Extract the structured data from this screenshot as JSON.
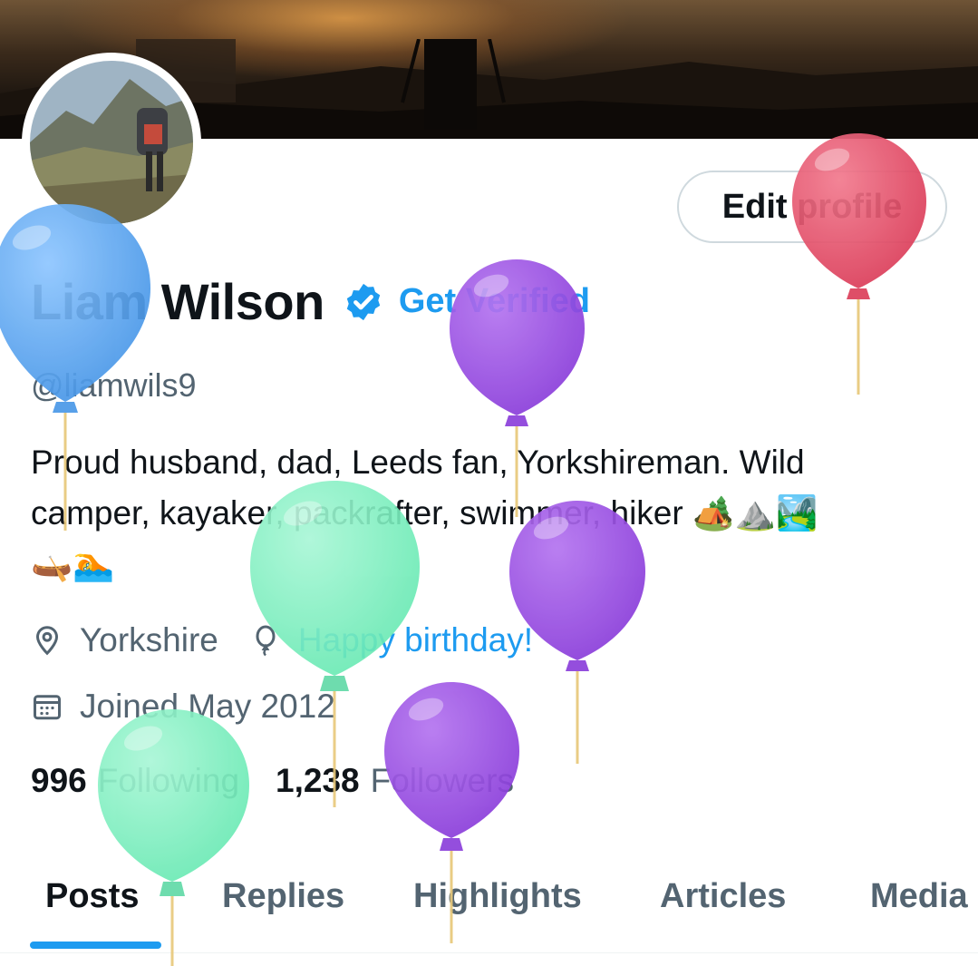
{
  "profile": {
    "name": "Liam Wilson",
    "get_verified": "Get Verified",
    "handle": "@liamwils9",
    "edit_button": "Edit profile",
    "bio_line1": "Proud husband, dad, Leeds fan, Yorkshireman. Wild",
    "bio_line2": "camper, kayaker, packrafter, swimmer, hiker 🏕️⛰️🏞️",
    "bio_line3": "🛶🏊",
    "location": "Yorkshire",
    "birthday": "Happy birthday!",
    "joined": "Joined May 2012",
    "following_count": "996",
    "following_label": "Following",
    "followers_count": "1,238",
    "followers_label": "Followers"
  },
  "tabs": [
    "Posts",
    "Replies",
    "Highlights",
    "Articles",
    "Media"
  ],
  "active_tab": "Posts",
  "colors": {
    "accent": "#1d9bf0",
    "text": "#0f1419",
    "secondary": "#536471",
    "balloon_blue": "#5aa9f0",
    "balloon_red": "#e5566e",
    "balloon_purple": "#9b4fe0",
    "balloon_green": "#7ef0c0"
  },
  "icons": {
    "verified": "verified-badge-icon",
    "location": "location-pin-icon",
    "birthday": "balloon-icon",
    "joined": "calendar-icon"
  }
}
